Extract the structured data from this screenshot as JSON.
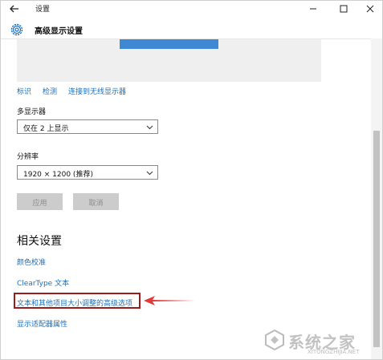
{
  "window": {
    "title": "设置",
    "controls": [
      "minimize-icon",
      "maximize-icon",
      "close-icon"
    ]
  },
  "header": {
    "icon": "gear-icon",
    "title": "高级显示设置"
  },
  "links": {
    "identify": "标识",
    "detect": "检测",
    "wireless": "连接到无线显示器"
  },
  "multi_display": {
    "label": "多显示器",
    "value": "仅在 2 上显示"
  },
  "resolution": {
    "label": "分辨率",
    "value": "1920 × 1200 (推荐)"
  },
  "buttons": {
    "apply": "应用",
    "cancel": "取消"
  },
  "related": {
    "title": "相关设置",
    "items": [
      "颜色校准",
      "ClearType 文本",
      "文本和其他项目大小调整的高级选项",
      "显示适配器属性"
    ]
  },
  "watermark": {
    "text": "系统之家",
    "url": "XITONGZHIJIA.NET"
  },
  "colors": {
    "accent": "#3f88d3",
    "link": "#1f6fb5",
    "highlight_border": "#9b1c1c",
    "arrow": "#e03a3a",
    "button_disabled": "#cccccc"
  }
}
